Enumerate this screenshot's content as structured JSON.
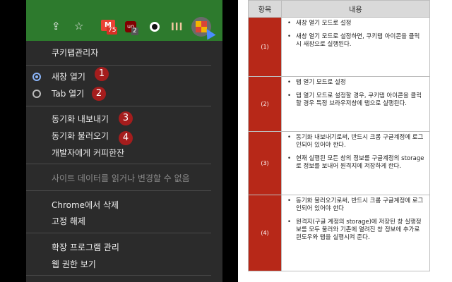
{
  "toolbar": {
    "icons": [
      "share-icon",
      "star-icon",
      "gmail-icon",
      "ublock-icon",
      "dot-extension-icon",
      "bars-extension-icon",
      "kuki-tab-extension-icon"
    ],
    "star": "☆",
    "share": "⇪",
    "gmail_letter": "M",
    "gmail_badge": "75",
    "ublock_letter": "uo",
    "ublock_badge": "2",
    "bars_label": "lll"
  },
  "menu": {
    "title": "쿠키탭관리자",
    "open_new_window": "새창 열기",
    "open_tab": "Tab 열기",
    "export_sync": "동기화 내보내기",
    "import_sync": "동기화 불러오기",
    "buy_coffee": "개발자에게 커피한잔",
    "site_data": "사이트 데이터를 읽거나 변경할 수 없음",
    "remove_chrome": "Chrome에서 삭제",
    "unpin": "고정 해제",
    "manage_ext": "확장 프로그램 관리",
    "view_perms": "웹 권한 보기",
    "badges": [
      "1",
      "2",
      "3",
      "4"
    ],
    "selected_mode": "새창 열기"
  },
  "table": {
    "headers": [
      "항목",
      "내용"
    ],
    "rows": [
      {
        "label": "(1)",
        "items": [
          "새창 열기 모드로 설정",
          "새창 열기 모드로 설정하면, 쿠키탭 아이콘을 클릭시 새창으로 실행된다."
        ]
      },
      {
        "label": "(2)",
        "items": [
          "탭 열기 모드로 설정",
          "탭 열기 모드로 설정할 경우, 쿠키탭 아이콘을 클릭할 경우 특정 브라우저창에 탭으로 실행된다."
        ]
      },
      {
        "label": "(3)",
        "items": [
          "동기화 내보내기로써, 반드시 크롬 구글계정에 로그인되어 있어야 한다.",
          "현재 실행된 모든 창의 정보를 구글계정의 storage로 정보를 보내어 원격지에 저장하게 한다."
        ]
      },
      {
        "label": "(4)",
        "items": [
          "동기화 불러오기로써, 반드시 크롬 구글계정에 로그인되어 있어야 한다",
          "원격지(구글 계정의 storage)에 저장된 창 실행정보를 모두 불러와 기존에 열려진 창 정보에 추가로 윈도우와 탭을 실행시켜 준다."
        ]
      }
    ]
  },
  "colors": {
    "toolbar_green": "#2d7a2d",
    "menu_bg": "#2b2b2b",
    "badge_red": "#a51d1d",
    "table_label_red": "#b72818",
    "radio_blue": "#8ab4f8"
  }
}
